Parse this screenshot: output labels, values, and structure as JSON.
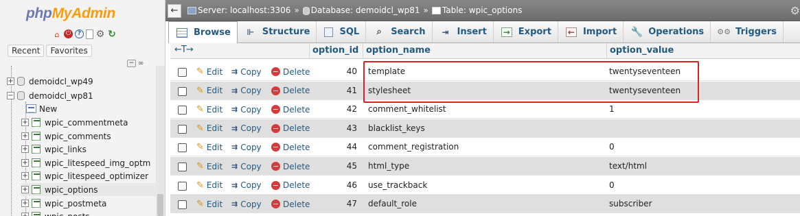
{
  "nav": {
    "logo_part1": "php",
    "logo_part2": "MyAdmin",
    "icons": [
      "home-icon",
      "exit-icon",
      "docs-icon",
      "page-icon",
      "settings-gear-icon",
      "reload-icon"
    ],
    "tab_recent": "Recent",
    "tab_favorites": "Favorites",
    "collapse_label": "−",
    "link_label": "∞",
    "databases": [
      {
        "name": "demoidcl_wp49",
        "toggle": "+"
      },
      {
        "name": "demoidcl_wp81",
        "toggle": "−"
      }
    ],
    "new_label": "New",
    "tables": [
      "wpic_commentmeta",
      "wpic_comments",
      "wpic_links",
      "wpic_litespeed_img_optm",
      "wpic_litespeed_optimizer",
      "wpic_options",
      "wpic_postmeta",
      "wpic_posts"
    ],
    "selected_table": "wpic_options"
  },
  "topbar": {
    "back": "←",
    "server": "Server: localhost:3306",
    "database": "Database: demoidcl_wp81",
    "table": "Table: wpic_options",
    "separator": "»"
  },
  "tabs": [
    {
      "label": "Browse",
      "icon": "browse-icon",
      "active": true
    },
    {
      "label": "Structure",
      "icon": "structure-icon"
    },
    {
      "label": "SQL",
      "icon": "sql-icon"
    },
    {
      "label": "Search",
      "icon": "search-icon"
    },
    {
      "label": "Insert",
      "icon": "insert-icon"
    },
    {
      "label": "Export",
      "icon": "export-icon"
    },
    {
      "label": "Import",
      "icon": "import-icon"
    },
    {
      "label": "Operations",
      "icon": "operations-icon"
    },
    {
      "label": "Triggers",
      "icon": "triggers-icon"
    }
  ],
  "table": {
    "arrows": "←T→",
    "columns": [
      "option_id",
      "option_name",
      "option_value"
    ],
    "actions": {
      "edit": "Edit",
      "copy": "Copy",
      "delete": "Delete"
    },
    "rows": [
      {
        "option_id": "40",
        "option_name": "template",
        "option_value": "twentyseventeen"
      },
      {
        "option_id": "41",
        "option_name": "stylesheet",
        "option_value": "twentyseventeen"
      },
      {
        "option_id": "42",
        "option_name": "comment_whitelist",
        "option_value": "1"
      },
      {
        "option_id": "43",
        "option_name": "blacklist_keys",
        "option_value": ""
      },
      {
        "option_id": "44",
        "option_name": "comment_registration",
        "option_value": "0"
      },
      {
        "option_id": "45",
        "option_name": "html_type",
        "option_value": "text/html"
      },
      {
        "option_id": "46",
        "option_name": "use_trackback",
        "option_value": "0"
      },
      {
        "option_id": "47",
        "option_name": "default_role",
        "option_value": "subscriber"
      }
    ],
    "highlight_color": "#e02020"
  }
}
